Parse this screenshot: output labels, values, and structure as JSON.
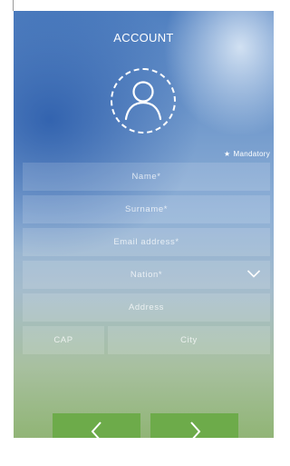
{
  "header": {
    "title": "ACCOUNT"
  },
  "avatar": {
    "icon": "user-icon"
  },
  "mandatory_note": {
    "star": "★",
    "text": "Mandatory"
  },
  "form": {
    "name_placeholder": "Name*",
    "surname_placeholder": "Surname*",
    "email_placeholder": "Email address*",
    "nation_placeholder": "Nation*",
    "address_placeholder": "Address",
    "cap_placeholder": "CAP",
    "city_placeholder": "City"
  },
  "nav": {
    "back_icon": "chevron-left-icon",
    "next_icon": "chevron-right-icon"
  },
  "colors": {
    "button_green": "#6dab4a",
    "text_white": "#ffffff"
  }
}
